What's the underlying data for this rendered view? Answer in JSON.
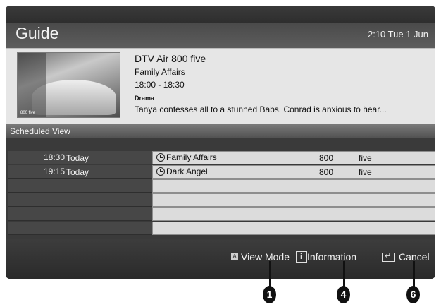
{
  "header": {
    "title": "Guide",
    "clock": "2:10 Tue 1 Jun"
  },
  "info": {
    "thumbnail_caption": "800 five",
    "channel_title": "DTV Air 800 five",
    "programme": "Family Affairs",
    "time": "18:00 - 18:30",
    "genre": "Drama",
    "description": "Tanya confesses all to a stunned Babs. Conrad is anxious to hear..."
  },
  "schedule": {
    "label": "Scheduled View",
    "rows": [
      {
        "time": "18:30",
        "day": "Today",
        "programme": "Family Affairs",
        "channel_number": "800",
        "channel_name": "five"
      },
      {
        "time": "19:15",
        "day": "Today",
        "programme": "Dark Angel",
        "channel_number": "800",
        "channel_name": "five"
      },
      {
        "time": "",
        "day": "",
        "programme": "",
        "channel_number": "",
        "channel_name": ""
      },
      {
        "time": "",
        "day": "",
        "programme": "",
        "channel_number": "",
        "channel_name": ""
      },
      {
        "time": "",
        "day": "",
        "programme": "",
        "channel_number": "",
        "channel_name": ""
      },
      {
        "time": "",
        "day": "",
        "programme": "",
        "channel_number": "",
        "channel_name": ""
      }
    ]
  },
  "footer": {
    "view_mode_key": "A",
    "view_mode_label": "View Mode",
    "information_key": "i",
    "information_label": "Information",
    "cancel_label": "Cancel"
  },
  "callouts": [
    "1",
    "4",
    "6"
  ]
}
